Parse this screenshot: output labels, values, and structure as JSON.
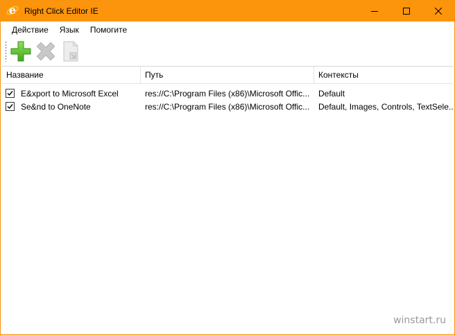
{
  "window": {
    "title": "Right Click Editor IE",
    "accent_color": "#fc950c"
  },
  "menu": {
    "items": [
      {
        "label": "Действие"
      },
      {
        "label": "Язык"
      },
      {
        "label": "Помогите"
      }
    ]
  },
  "toolbar": {
    "buttons": [
      {
        "name": "add",
        "icon": "plus-icon",
        "enabled": true
      },
      {
        "name": "delete",
        "icon": "x-icon",
        "enabled": false
      },
      {
        "name": "edit",
        "icon": "document-icon",
        "enabled": false
      }
    ]
  },
  "list": {
    "columns": [
      "Название",
      "Путь",
      "Контексты"
    ],
    "rows": [
      {
        "checked": true,
        "name": "E&xport to Microsoft Excel",
        "path": "res://C:\\Program Files (x86)\\Microsoft Offic...",
        "contexts": "Default"
      },
      {
        "checked": true,
        "name": "Se&nd to OneNote",
        "path": "res://C:\\Program Files (x86)\\Microsoft Offic...",
        "contexts": "Default, Images, Controls, TextSele..."
      }
    ]
  },
  "watermark": "winstart.ru"
}
